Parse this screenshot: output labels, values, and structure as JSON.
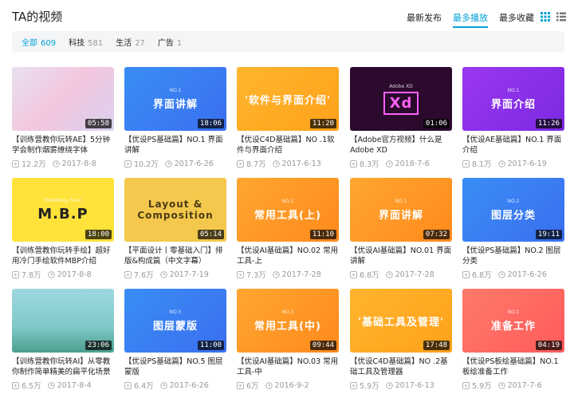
{
  "header": {
    "title": "TA的视频",
    "sort_tabs": [
      {
        "label": "最新发布",
        "active": false
      },
      {
        "label": "最多播放",
        "active": true
      },
      {
        "label": "最多收藏",
        "active": false
      }
    ],
    "view_icons": [
      "grid-view-icon",
      "list-view-icon"
    ]
  },
  "filters": [
    {
      "label": "全部",
      "count": "609",
      "active": true
    },
    {
      "label": "科技",
      "count": "581",
      "active": false
    },
    {
      "label": "生活",
      "count": "27",
      "active": false
    },
    {
      "label": "广告",
      "count": "1",
      "active": false
    }
  ],
  "colors": {
    "accent": "#00a1d6"
  },
  "videos": [
    {
      "title": "【训练营教你玩转AE】5分钟学会制作烟雾缭绕字体",
      "duration": "05:58",
      "plays": "12.2万",
      "date": "2017-8-8",
      "thumb_text": "",
      "badge": "",
      "bg": "linear-gradient(135deg,#e8e0f0,#f3c6df 50%,#d9d2ef)"
    },
    {
      "title": "【优设PS基础篇】NO.1 界面讲解",
      "duration": "18:06",
      "plays": "10.2万",
      "date": "2017-6-26",
      "thumb_text": "界面讲解",
      "badge": "NO.1",
      "bg": "linear-gradient(135deg,#3a8df5,#3a6ff0)"
    },
    {
      "title": "【优设C4D基础篇】NO .1软件与界面介绍",
      "duration": "11:20",
      "plays": "8.7万",
      "date": "2017-6-13",
      "thumb_text": "'软件与界面介绍'",
      "badge": "",
      "bg": "linear-gradient(135deg,#ffb52e,#ffa11a)"
    },
    {
      "title": "【Adobe官方视频】什么是Adobe XD",
      "duration": "01:06",
      "plays": "8.3万",
      "date": "2018-7-6",
      "thumb_text": "Xd",
      "badge": "Adobe XD",
      "bg": "#2b0a2e"
    },
    {
      "title": "【优设AE基础篇】NO.1 界面介绍",
      "duration": "11:26",
      "plays": "8.1万",
      "date": "2017-6-19",
      "thumb_text": "界面介绍",
      "badge": "NO.1",
      "bg": "linear-gradient(135deg,#9a37f0,#7b2ae0)"
    },
    {
      "title": "【训练营教你玩转手绘】超好用冷门手绘软件MBP介绍",
      "duration": "18:00",
      "plays": "7.8万",
      "date": "2017-8-8",
      "thumb_text": "M.B.P",
      "badge": "MediBang Paint",
      "bg": "#ffe23a"
    },
    {
      "title": "【平面设计丨零基础入门】排版&构成篇（中文字幕）",
      "duration": "05:14",
      "plays": "7.6万",
      "date": "2017-7-19",
      "thumb_text": "Layout & Composition",
      "badge": "",
      "bg": "#f3c84d"
    },
    {
      "title": "【优设AI基础篇】NO.02 常用工具-上",
      "duration": "11:10",
      "plays": "7.3万",
      "date": "2017-7-28",
      "thumb_text": "常用工具(上)",
      "badge": "NO.2",
      "bg": "linear-gradient(135deg,#ffa630,#ff8a1c)"
    },
    {
      "title": "【优设AI基础篇】NO.01 界面讲解",
      "duration": "07:32",
      "plays": "6.8万",
      "date": "2017-7-28",
      "thumb_text": "界面讲解",
      "badge": "NO.1",
      "bg": "linear-gradient(135deg,#ffa630,#ff8a1c)"
    },
    {
      "title": "【优设PS基础篇】NO.2 图层分类",
      "duration": "19:11",
      "plays": "6.8万",
      "date": "2017-6-26",
      "thumb_text": "图层分类",
      "badge": "NO.2",
      "bg": "linear-gradient(135deg,#3a8df5,#3a6ff0)"
    },
    {
      "title": "【训练营教你玩转AI】从零教你制作简单精美的扁平化场景插画",
      "duration": "23:06",
      "plays": "6.5万",
      "date": "2017-8-4",
      "thumb_text": "",
      "badge": "",
      "bg": "linear-gradient(180deg,#9fd8e0,#7fc9c8 60%,#4c9f8e)"
    },
    {
      "title": "【优设PS基础篇】NO.5 图层蒙版",
      "duration": "11:00",
      "plays": "6.4万",
      "date": "2017-6-26",
      "thumb_text": "图层蒙版",
      "badge": "NO.5",
      "bg": "linear-gradient(135deg,#3a8df5,#3a6ff0)"
    },
    {
      "title": "【优设AI基础篇】NO.03 常用工具-中",
      "duration": "09:44",
      "plays": "6万",
      "date": "2016-9-2",
      "thumb_text": "常用工具(中)",
      "badge": "NO.3",
      "bg": "linear-gradient(135deg,#ffa630,#ff8a1c)"
    },
    {
      "title": "【优设C4D基础篇】NO .2基础工具及管理器",
      "duration": "17:48",
      "plays": "5.9万",
      "date": "2017-6-13",
      "thumb_text": "'基础工具及管理'",
      "badge": "",
      "bg": "linear-gradient(135deg,#ffb52e,#ffa11a)"
    },
    {
      "title": "【优设PS板绘基础篇】NO.1 板绘准备工作",
      "duration": "04:19",
      "plays": "5.9万",
      "date": "2017-7-6",
      "thumb_text": "准备工作",
      "badge": "NO.1",
      "bg": "linear-gradient(135deg,#ff7a6a,#ff5b5b)"
    }
  ]
}
